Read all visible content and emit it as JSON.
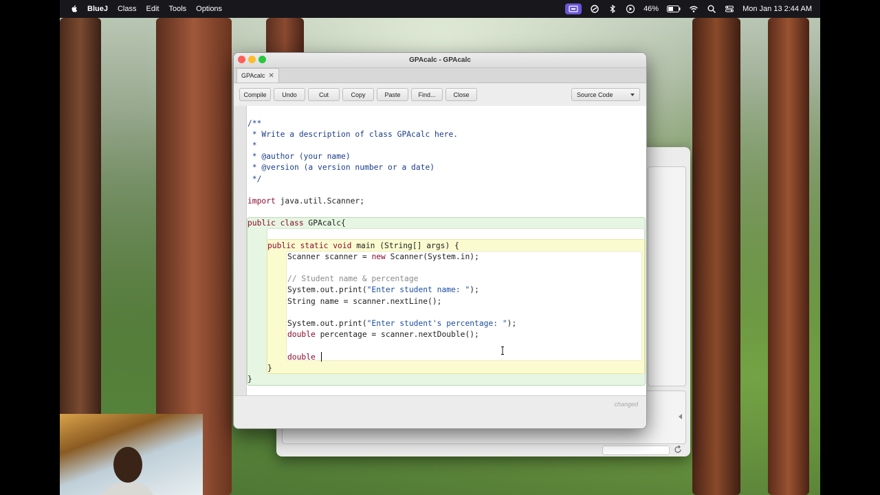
{
  "menubar": {
    "app_name": "BlueJ",
    "menus": [
      "Class",
      "Edit",
      "Tools",
      "Options"
    ],
    "battery": "46%",
    "datetime": "Mon Jan 13  2:44 AM"
  },
  "editor": {
    "window_title": "GPAcalc - GPAcalc",
    "tab_label": "GPAcalc",
    "toolbar": {
      "compile": "Compile",
      "undo": "Undo",
      "cut": "Cut",
      "copy": "Copy",
      "paste": "Paste",
      "find": "Find...",
      "close": "Close",
      "view_select": "Source Code"
    },
    "code": {
      "l1": "/**",
      "l2": " * Write a description of class GPAcalc here.",
      "l3": " *",
      "l4": " * @author (your name)",
      "l5": " * @version (a version number or a date)",
      "l6": " */",
      "l7_kw": "import",
      "l7_rest": " java.util.Scanner;",
      "l8_kw": "public class",
      "l8_rest": " GPAcalc{",
      "l9_kw": "public static void",
      "l9_rest": " main (String[] args) {",
      "l10_a": "Scanner scanner = ",
      "l10_kw": "new",
      "l10_b": " Scanner(System.in);",
      "l11_comment": "// Student name & percentage",
      "l12_a": "System.out.print(",
      "l12_str": "\"Enter student name: \"",
      "l12_b": ");",
      "l13": "String name = scanner.nextLine();",
      "l14_a": "System.out.print(",
      "l14_str": "\"Enter student's percentage: \"",
      "l14_b": ");",
      "l15_kw": "double",
      "l15_rest": " percentage = scanner.nextDouble();",
      "l16_kw": "double",
      "l17": "}",
      "l18": "}"
    },
    "status": "changed"
  },
  "colors": {
    "keyword": "#8a0a2c",
    "comment": "#1b3d8c",
    "string": "#1b4fa0",
    "class_scope": "#e6f6e3",
    "method_scope": "#fbfbd0"
  }
}
